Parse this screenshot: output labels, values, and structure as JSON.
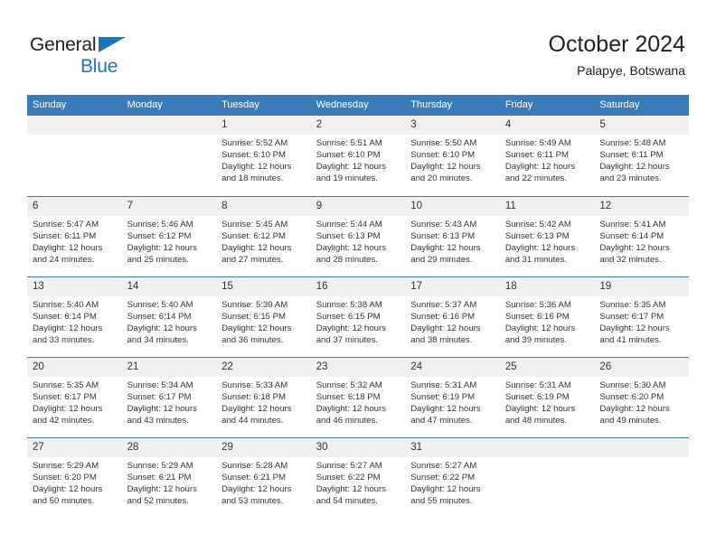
{
  "brand": {
    "line1": "General",
    "line2": "Blue",
    "triangle_color": "#1b75bb",
    "text_color": "#231f20"
  },
  "header": {
    "title": "October 2024",
    "subtitle": "Palapye, Botswana"
  },
  "theme": {
    "header_blue": "#3b7cb8",
    "daynum_bg": "#f0f0f0",
    "text": "#333333"
  },
  "weekday_headers": [
    "Sunday",
    "Monday",
    "Tuesday",
    "Wednesday",
    "Thursday",
    "Friday",
    "Saturday"
  ],
  "weeks": [
    [
      {
        "day": "",
        "lines": [
          "",
          "",
          "",
          ""
        ]
      },
      {
        "day": "",
        "lines": [
          "",
          "",
          "",
          ""
        ]
      },
      {
        "day": "1",
        "lines": [
          "Sunrise: 5:52 AM",
          "Sunset: 6:10 PM",
          "Daylight: 12 hours",
          "and 18 minutes."
        ]
      },
      {
        "day": "2",
        "lines": [
          "Sunrise: 5:51 AM",
          "Sunset: 6:10 PM",
          "Daylight: 12 hours",
          "and 19 minutes."
        ]
      },
      {
        "day": "3",
        "lines": [
          "Sunrise: 5:50 AM",
          "Sunset: 6:10 PM",
          "Daylight: 12 hours",
          "and 20 minutes."
        ]
      },
      {
        "day": "4",
        "lines": [
          "Sunrise: 5:49 AM",
          "Sunset: 6:11 PM",
          "Daylight: 12 hours",
          "and 22 minutes."
        ]
      },
      {
        "day": "5",
        "lines": [
          "Sunrise: 5:48 AM",
          "Sunset: 6:11 PM",
          "Daylight: 12 hours",
          "and 23 minutes."
        ]
      }
    ],
    [
      {
        "day": "6",
        "lines": [
          "Sunrise: 5:47 AM",
          "Sunset: 6:11 PM",
          "Daylight: 12 hours",
          "and 24 minutes."
        ]
      },
      {
        "day": "7",
        "lines": [
          "Sunrise: 5:46 AM",
          "Sunset: 6:12 PM",
          "Daylight: 12 hours",
          "and 25 minutes."
        ]
      },
      {
        "day": "8",
        "lines": [
          "Sunrise: 5:45 AM",
          "Sunset: 6:12 PM",
          "Daylight: 12 hours",
          "and 27 minutes."
        ]
      },
      {
        "day": "9",
        "lines": [
          "Sunrise: 5:44 AM",
          "Sunset: 6:13 PM",
          "Daylight: 12 hours",
          "and 28 minutes."
        ]
      },
      {
        "day": "10",
        "lines": [
          "Sunrise: 5:43 AM",
          "Sunset: 6:13 PM",
          "Daylight: 12 hours",
          "and 29 minutes."
        ]
      },
      {
        "day": "11",
        "lines": [
          "Sunrise: 5:42 AM",
          "Sunset: 6:13 PM",
          "Daylight: 12 hours",
          "and 31 minutes."
        ]
      },
      {
        "day": "12",
        "lines": [
          "Sunrise: 5:41 AM",
          "Sunset: 6:14 PM",
          "Daylight: 12 hours",
          "and 32 minutes."
        ]
      }
    ],
    [
      {
        "day": "13",
        "lines": [
          "Sunrise: 5:40 AM",
          "Sunset: 6:14 PM",
          "Daylight: 12 hours",
          "and 33 minutes."
        ]
      },
      {
        "day": "14",
        "lines": [
          "Sunrise: 5:40 AM",
          "Sunset: 6:14 PM",
          "Daylight: 12 hours",
          "and 34 minutes."
        ]
      },
      {
        "day": "15",
        "lines": [
          "Sunrise: 5:39 AM",
          "Sunset: 6:15 PM",
          "Daylight: 12 hours",
          "and 36 minutes."
        ]
      },
      {
        "day": "16",
        "lines": [
          "Sunrise: 5:38 AM",
          "Sunset: 6:15 PM",
          "Daylight: 12 hours",
          "and 37 minutes."
        ]
      },
      {
        "day": "17",
        "lines": [
          "Sunrise: 5:37 AM",
          "Sunset: 6:16 PM",
          "Daylight: 12 hours",
          "and 38 minutes."
        ]
      },
      {
        "day": "18",
        "lines": [
          "Sunrise: 5:36 AM",
          "Sunset: 6:16 PM",
          "Daylight: 12 hours",
          "and 39 minutes."
        ]
      },
      {
        "day": "19",
        "lines": [
          "Sunrise: 5:35 AM",
          "Sunset: 6:17 PM",
          "Daylight: 12 hours",
          "and 41 minutes."
        ]
      }
    ],
    [
      {
        "day": "20",
        "lines": [
          "Sunrise: 5:35 AM",
          "Sunset: 6:17 PM",
          "Daylight: 12 hours",
          "and 42 minutes."
        ]
      },
      {
        "day": "21",
        "lines": [
          "Sunrise: 5:34 AM",
          "Sunset: 6:17 PM",
          "Daylight: 12 hours",
          "and 43 minutes."
        ]
      },
      {
        "day": "22",
        "lines": [
          "Sunrise: 5:33 AM",
          "Sunset: 6:18 PM",
          "Daylight: 12 hours",
          "and 44 minutes."
        ]
      },
      {
        "day": "23",
        "lines": [
          "Sunrise: 5:32 AM",
          "Sunset: 6:18 PM",
          "Daylight: 12 hours",
          "and 46 minutes."
        ]
      },
      {
        "day": "24",
        "lines": [
          "Sunrise: 5:31 AM",
          "Sunset: 6:19 PM",
          "Daylight: 12 hours",
          "and 47 minutes."
        ]
      },
      {
        "day": "25",
        "lines": [
          "Sunrise: 5:31 AM",
          "Sunset: 6:19 PM",
          "Daylight: 12 hours",
          "and 48 minutes."
        ]
      },
      {
        "day": "26",
        "lines": [
          "Sunrise: 5:30 AM",
          "Sunset: 6:20 PM",
          "Daylight: 12 hours",
          "and 49 minutes."
        ]
      }
    ],
    [
      {
        "day": "27",
        "lines": [
          "Sunrise: 5:29 AM",
          "Sunset: 6:20 PM",
          "Daylight: 12 hours",
          "and 50 minutes."
        ]
      },
      {
        "day": "28",
        "lines": [
          "Sunrise: 5:29 AM",
          "Sunset: 6:21 PM",
          "Daylight: 12 hours",
          "and 52 minutes."
        ]
      },
      {
        "day": "29",
        "lines": [
          "Sunrise: 5:28 AM",
          "Sunset: 6:21 PM",
          "Daylight: 12 hours",
          "and 53 minutes."
        ]
      },
      {
        "day": "30",
        "lines": [
          "Sunrise: 5:27 AM",
          "Sunset: 6:22 PM",
          "Daylight: 12 hours",
          "and 54 minutes."
        ]
      },
      {
        "day": "31",
        "lines": [
          "Sunrise: 5:27 AM",
          "Sunset: 6:22 PM",
          "Daylight: 12 hours",
          "and 55 minutes."
        ]
      },
      {
        "day": "",
        "lines": [
          "",
          "",
          "",
          ""
        ]
      },
      {
        "day": "",
        "lines": [
          "",
          "",
          "",
          ""
        ]
      }
    ]
  ]
}
